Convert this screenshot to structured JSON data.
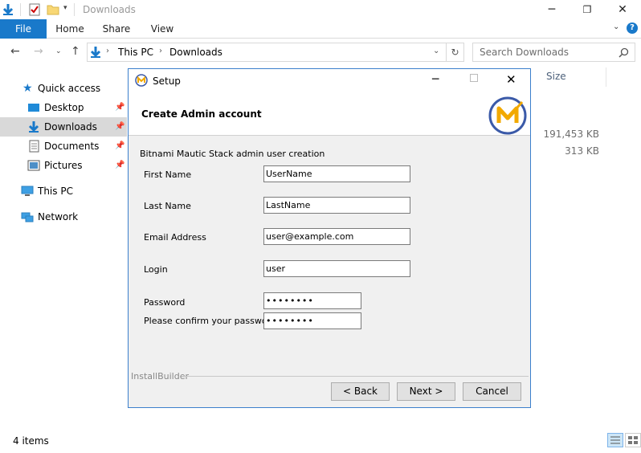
{
  "window": {
    "title": "Downloads"
  },
  "ribbon": {
    "tabs": [
      "File",
      "Home",
      "Share",
      "View"
    ]
  },
  "address": {
    "crumbs": [
      "This PC",
      "Downloads"
    ],
    "search_placeholder": "Search Downloads"
  },
  "nav": {
    "items": [
      {
        "label": "Quick access",
        "icon": "star-icon"
      },
      {
        "label": "Desktop",
        "icon": "desktop-icon",
        "pinned": true
      },
      {
        "label": "Downloads",
        "icon": "download-icon",
        "pinned": true,
        "selected": true
      },
      {
        "label": "Documents",
        "icon": "document-icon",
        "pinned": true
      },
      {
        "label": "Pictures",
        "icon": "pictures-icon",
        "pinned": true
      },
      {
        "label": "This PC",
        "icon": "computer-icon"
      },
      {
        "label": "Network",
        "icon": "network-icon"
      }
    ]
  },
  "content": {
    "column_size": "Size",
    "sizes": [
      "191,453 KB",
      "313 KB"
    ]
  },
  "status": {
    "count": "4 items"
  },
  "dialog": {
    "title": "Setup",
    "heading": "Create Admin account",
    "intro": "Bitnami Mautic Stack admin user creation",
    "fields": {
      "first_name": {
        "label": "First Name",
        "value": "UserName"
      },
      "last_name": {
        "label": "Last Name",
        "value": "LastName"
      },
      "email": {
        "label": "Email Address",
        "value": "user@example.com"
      },
      "login": {
        "label": "Login",
        "value": "user"
      },
      "password": {
        "label": "Password",
        "value": "••••••••"
      },
      "confirm": {
        "label": "Please confirm your password",
        "value": "••••••••"
      }
    },
    "footer_brand": "InstallBuilder",
    "buttons": {
      "back": "< Back",
      "next": "Next >",
      "cancel": "Cancel"
    },
    "brand_color": "#f2a900",
    "accent_color": "#3b5aa8"
  }
}
